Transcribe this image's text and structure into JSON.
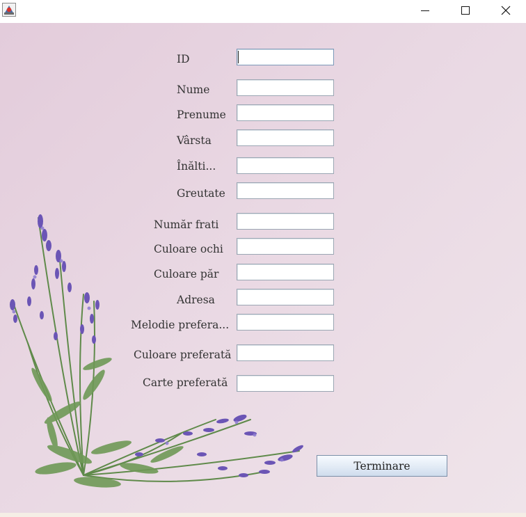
{
  "window": {
    "icon": "java-app-icon",
    "controls": [
      "minimize-icon",
      "maximize-icon",
      "close-icon"
    ]
  },
  "form": {
    "labels": {
      "id": "ID",
      "nume": "Nume",
      "prenume": "Prenume",
      "varsta": "Vârsta",
      "inaltime": "Înălti...",
      "greutate": "Greutate",
      "numar_frati": "Număr frati",
      "culoare_ochi": "Culoare ochi",
      "culoare_par": "Culoare păr",
      "adresa": "Adresa",
      "melodie": "Melodie prefera...",
      "culoare_preferata": "Culoare preferată",
      "carte_preferata": "Carte preferată"
    },
    "values": {
      "id": "",
      "nume": "",
      "prenume": "",
      "varsta": "",
      "inaltime": "",
      "greutate": "",
      "numar_frati": "",
      "culoare_ochi": "",
      "culoare_par": "",
      "adresa": "",
      "melodie": "",
      "culoare_preferata": "",
      "carte_preferata": ""
    },
    "submit_label": "Terminare"
  },
  "background": {
    "image": "lavender-sprigs",
    "colors": {
      "base": "#e6d3df",
      "flower": "#6b55b5",
      "stem": "#5f8a4a"
    }
  }
}
